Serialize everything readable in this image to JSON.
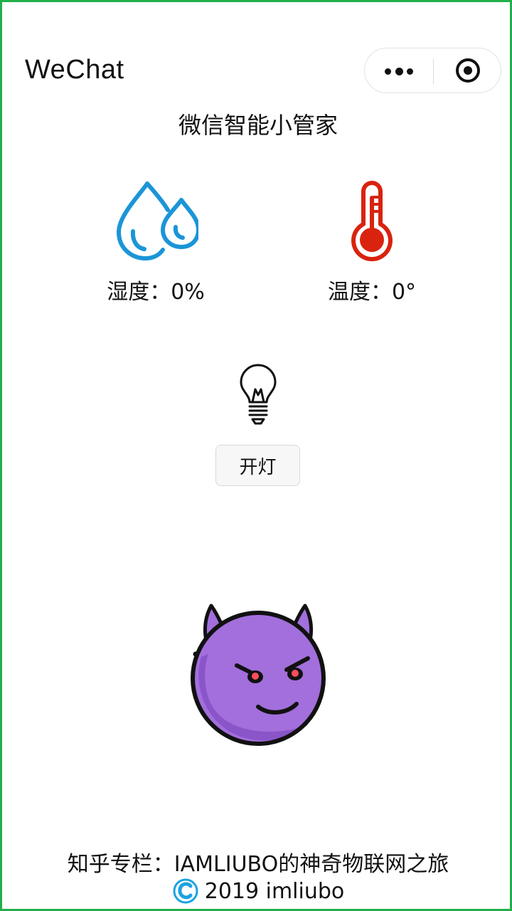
{
  "navbar": {
    "title": "WeChat",
    "more_icon": "more-dots-icon",
    "close_icon": "close-target-icon"
  },
  "page": {
    "title": "微信智能小管家"
  },
  "humidity": {
    "icon": "water-drops-icon",
    "label": "湿度：0%",
    "color": "#1b95d8"
  },
  "temperature": {
    "icon": "thermometer-icon",
    "label": "温度：0°",
    "color": "#d9230f"
  },
  "light": {
    "icon": "light-bulb-icon",
    "button_label": "开灯"
  },
  "mascot": {
    "icon": "purple-devil-icon",
    "color": "#a26fdc"
  },
  "footer": {
    "column": "知乎专栏：IAMLIUBO的神奇物联网之旅",
    "copyright": "2019 imliubo",
    "copyright_icon": "copyright-icon",
    "copyright_color": "#1aa3e0"
  }
}
